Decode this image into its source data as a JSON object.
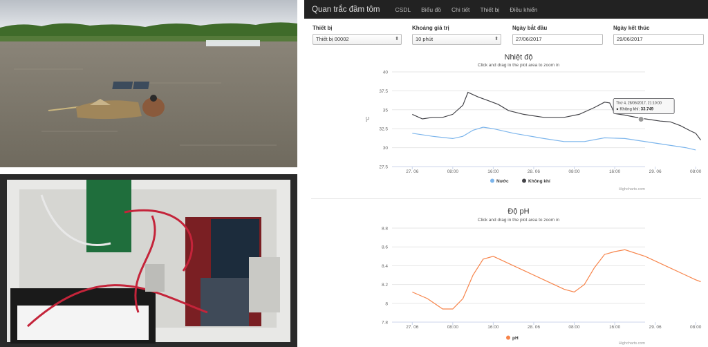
{
  "nav": {
    "brand": "Quan trắc đầm tôm",
    "links": [
      "CSDL",
      "Biểu đồ",
      "Chi tiết",
      "Thiết bị",
      "Điều khiển"
    ]
  },
  "filters": {
    "device_label": "Thiết bị",
    "device_value": "Thiết bị 00002",
    "interval_label": "Khoảng giá trị",
    "interval_value": "10 phút",
    "start_label": "Ngày bắt đầu",
    "start_value": "27/06/2017",
    "end_label": "Ngày kết thúc",
    "end_value": "29/06/2017"
  },
  "credits": "Highcharts.com",
  "chart_data": [
    {
      "type": "line",
      "title": "Nhiệt độ",
      "subtitle": "Click and drag in the plot area to zoom in",
      "ylabel": "°C",
      "ylim": [
        27.5,
        40
      ],
      "yticks": [
        "27.5",
        "30",
        "32.5",
        "35",
        "37.5",
        "40"
      ],
      "xlim": [
        -4,
        46
      ],
      "x_ticks": [
        {
          "x": 0,
          "label": "27. 06"
        },
        {
          "x": 8,
          "label": "08:00"
        },
        {
          "x": 16,
          "label": "16:00"
        },
        {
          "x": 24,
          "label": "28. 06"
        },
        {
          "x": 32,
          "label": "08:00"
        },
        {
          "x": 40,
          "label": "16:00"
        },
        {
          "x": 48,
          "label": "29. 06"
        },
        {
          "x": 56,
          "label": "08:00"
        }
      ],
      "series": [
        {
          "name": "Nước",
          "color": "#7cb5ec",
          "points": [
            [
              0,
              31.9
            ],
            [
              4,
              31.5
            ],
            [
              8,
              31.2
            ],
            [
              10,
              31.5
            ],
            [
              12,
              32.3
            ],
            [
              14,
              32.7
            ],
            [
              16,
              32.5
            ],
            [
              20,
              31.9
            ],
            [
              26,
              31.2
            ],
            [
              30,
              30.8
            ],
            [
              34,
              30.8
            ],
            [
              38,
              31.3
            ],
            [
              42,
              31.2
            ],
            [
              48,
              30.6
            ],
            [
              54,
              30.0
            ],
            [
              56,
              29.7
            ]
          ]
        },
        {
          "name": "Không khí",
          "color": "#434348",
          "points": [
            [
              0,
              34.4
            ],
            [
              2,
              33.8
            ],
            [
              4,
              34.0
            ],
            [
              6,
              34.0
            ],
            [
              8,
              34.4
            ],
            [
              10,
              35.6
            ],
            [
              11,
              37.3
            ],
            [
              13,
              36.7
            ],
            [
              15,
              36.2
            ],
            [
              17,
              35.7
            ],
            [
              19,
              34.9
            ],
            [
              22,
              34.4
            ],
            [
              26,
              34.0
            ],
            [
              30,
              34.0
            ],
            [
              33,
              34.4
            ],
            [
              36,
              35.3
            ],
            [
              38,
              36.0
            ],
            [
              39,
              35.9
            ],
            [
              40,
              34.5
            ],
            [
              42,
              34.3
            ],
            [
              45,
              33.9
            ],
            [
              47,
              33.7
            ],
            [
              49,
              33.5
            ],
            [
              51,
              33.4
            ],
            [
              53,
              32.9
            ],
            [
              55,
              32.2
            ],
            [
              56,
              31.9
            ],
            [
              57,
              31.0
            ]
          ]
        }
      ],
      "tooltip": {
        "title": "Thứ 4, 28/06/2017, 21:10:00",
        "series": "Không khí",
        "value": "33.749",
        "x": 45.2,
        "y": 33.749
      }
    },
    {
      "type": "line",
      "title": "Độ pH",
      "subtitle": "Click and drag in the plot area to zoom in",
      "ylabel": "",
      "ylim": [
        7.8,
        8.8
      ],
      "yticks": [
        "7.8",
        "8",
        "8.2",
        "8.4",
        "8.6",
        "8.8"
      ],
      "xlim": [
        -4,
        46
      ],
      "x_ticks": [
        {
          "x": 0,
          "label": "27. 06"
        },
        {
          "x": 8,
          "label": "08:00"
        },
        {
          "x": 16,
          "label": "16:00"
        },
        {
          "x": 24,
          "label": "28. 06"
        },
        {
          "x": 32,
          "label": "08:00"
        },
        {
          "x": 40,
          "label": "16:00"
        },
        {
          "x": 48,
          "label": "29. 06"
        },
        {
          "x": 56,
          "label": "08:00"
        }
      ],
      "series": [
        {
          "name": "pH",
          "color": "#f7844a",
          "points": [
            [
              0,
              8.12
            ],
            [
              3,
              8.05
            ],
            [
              6,
              7.94
            ],
            [
              8,
              7.94
            ],
            [
              10,
              8.05
            ],
            [
              12,
              8.3
            ],
            [
              14,
              8.47
            ],
            [
              16,
              8.5
            ],
            [
              18,
              8.45
            ],
            [
              22,
              8.35
            ],
            [
              26,
              8.25
            ],
            [
              30,
              8.15
            ],
            [
              32,
              8.12
            ],
            [
              34,
              8.2
            ],
            [
              36,
              8.38
            ],
            [
              38,
              8.52
            ],
            [
              40,
              8.55
            ],
            [
              42,
              8.57
            ],
            [
              46,
              8.5
            ],
            [
              50,
              8.4
            ],
            [
              54,
              8.3
            ],
            [
              56,
              8.25
            ],
            [
              57,
              8.23
            ]
          ]
        }
      ]
    }
  ]
}
